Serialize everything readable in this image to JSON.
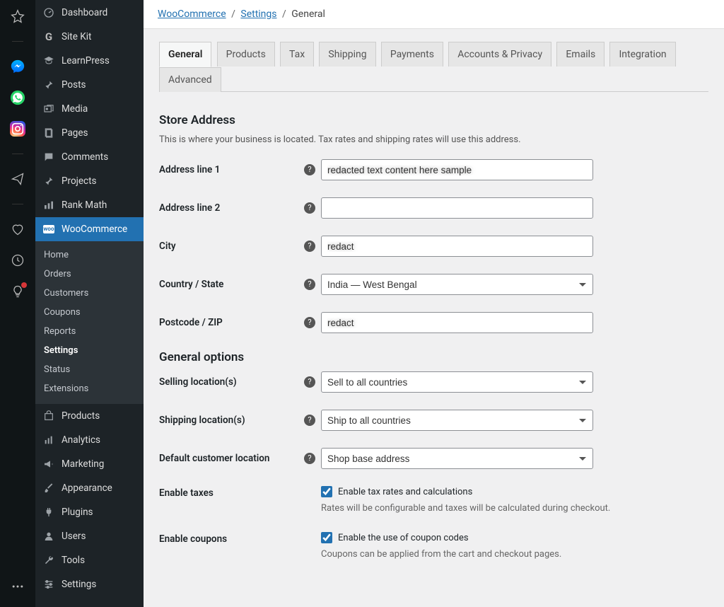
{
  "leftRail": {
    "icons": [
      "star",
      "messenger",
      "whatsapp",
      "instagram",
      "send",
      "heart",
      "clock",
      "bulb",
      "dots"
    ]
  },
  "sidebar": {
    "items": [
      {
        "label": "Dashboard",
        "icon": "dash"
      },
      {
        "label": "Site Kit",
        "icon": "g"
      },
      {
        "label": "LearnPress",
        "icon": "cap"
      },
      {
        "label": "Posts",
        "icon": "pin"
      },
      {
        "label": "Media",
        "icon": "media"
      },
      {
        "label": "Pages",
        "icon": "page"
      },
      {
        "label": "Comments",
        "icon": "comment"
      },
      {
        "label": "Projects",
        "icon": "pin"
      },
      {
        "label": "Rank Math",
        "icon": "bars"
      },
      {
        "label": "WooCommerce",
        "icon": "woo",
        "active": true
      },
      {
        "label": "Products",
        "icon": "prod"
      },
      {
        "label": "Analytics",
        "icon": "analytics"
      },
      {
        "label": "Marketing",
        "icon": "horn"
      },
      {
        "label": "Appearance",
        "icon": "brush"
      },
      {
        "label": "Plugins",
        "icon": "plug"
      },
      {
        "label": "Users",
        "icon": "user"
      },
      {
        "label": "Tools",
        "icon": "wrench"
      },
      {
        "label": "Settings",
        "icon": "slider"
      }
    ],
    "sub": {
      "items": [
        {
          "label": "Home"
        },
        {
          "label": "Orders"
        },
        {
          "label": "Customers"
        },
        {
          "label": "Coupons"
        },
        {
          "label": "Reports"
        },
        {
          "label": "Settings",
          "active": true
        },
        {
          "label": "Status"
        },
        {
          "label": "Extensions"
        }
      ]
    }
  },
  "breadcrumb": {
    "items": [
      {
        "label": "WooCommerce",
        "link": true
      },
      {
        "label": "Settings",
        "link": true
      },
      {
        "label": "General",
        "link": false
      }
    ]
  },
  "tabs": [
    {
      "label": "General",
      "active": true
    },
    {
      "label": "Products"
    },
    {
      "label": "Tax"
    },
    {
      "label": "Shipping"
    },
    {
      "label": "Payments"
    },
    {
      "label": "Accounts & Privacy"
    },
    {
      "label": "Emails"
    },
    {
      "label": "Integration"
    },
    {
      "label": "Advanced"
    }
  ],
  "sections": {
    "storeAddress": {
      "title": "Store Address",
      "desc": "This is where your business is located. Tax rates and shipping rates will use this address.",
      "fields": {
        "address1": {
          "label": "Address line 1",
          "value": "redacted text content here sample"
        },
        "address2": {
          "label": "Address line 2",
          "value": ""
        },
        "city": {
          "label": "City",
          "value": "redact"
        },
        "country": {
          "label": "Country / State",
          "value": "India — West Bengal"
        },
        "postcode": {
          "label": "Postcode / ZIP",
          "value": "redact"
        }
      }
    },
    "generalOptions": {
      "title": "General options",
      "fields": {
        "selling": {
          "label": "Selling location(s)",
          "value": "Sell to all countries"
        },
        "shipping": {
          "label": "Shipping location(s)",
          "value": "Ship to all countries"
        },
        "defaultLoc": {
          "label": "Default customer location",
          "value": "Shop base address"
        },
        "taxes": {
          "label": "Enable taxes",
          "check_label": "Enable tax rates and calculations",
          "hint": "Rates will be configurable and taxes will be calculated during checkout."
        },
        "coupons": {
          "label": "Enable coupons",
          "check_label": "Enable the use of coupon codes",
          "hint": "Coupons can be applied from the cart and checkout pages."
        }
      }
    }
  }
}
